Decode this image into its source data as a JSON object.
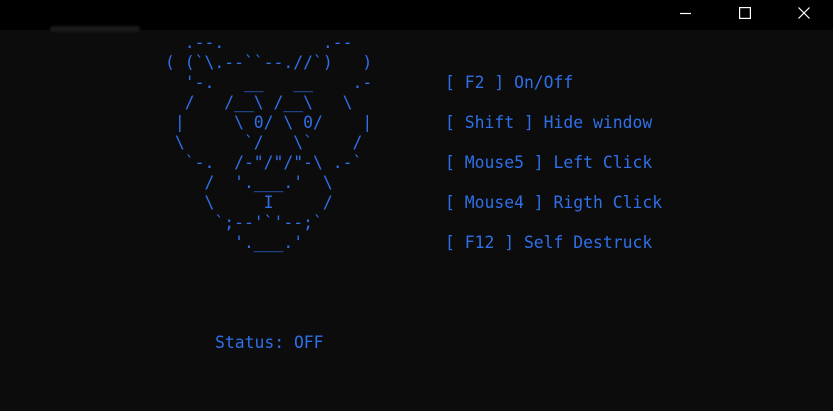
{
  "window": {
    "controls": {
      "minimize_icon": "minimize-icon",
      "maximize_icon": "maximize-icon",
      "close_icon": "close-icon"
    }
  },
  "console": {
    "text_color": "#2f6fe8",
    "background": "#0c0c0c",
    "ascii_art": [
      "  .--.          .--",
      "( (`\\.--``--.//`)   )",
      "  '-.   __   __    .-",
      "  /   /__\\ /__\\   \\",
      " |     \\ 0/ \\ 0/    |",
      " \\      `/   \\`    /",
      "  `-.  /-\"/\"/\"-\\ .-`",
      "    /  '.___.'  \\",
      "    \\     I     /",
      "     `;--'`'--;`",
      "       '.___.'"
    ],
    "keybinds": [
      "[ F2 ] On/Off",
      "[ Shift ] Hide window",
      "[ Mouse5 ] Left Click",
      "[ Mouse4 ] Rigth Click",
      "[ F12 ] Self Destruck"
    ],
    "status": "Status: OFF"
  }
}
